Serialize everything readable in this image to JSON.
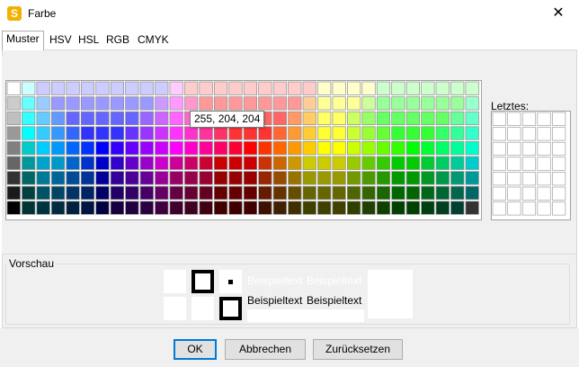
{
  "window": {
    "title": "Farbe",
    "icon": "app-logo-icon",
    "icon_glyph": "S",
    "close_glyph": "✕"
  },
  "tabs": [
    {
      "label": "Muster",
      "active": true
    },
    {
      "label": "HSV",
      "active": false
    },
    {
      "label": "HSL",
      "active": false
    },
    {
      "label": "RGB",
      "active": false
    },
    {
      "label": "CMYK",
      "active": false
    }
  ],
  "palette": {
    "tooltip": "255, 204, 204",
    "rows": [
      [
        "#FFFFFF",
        "#CCFFFF",
        "#CCCCFF",
        "#CCCCFF",
        "#CCCCFF",
        "#CCCCFF",
        "#CCCCFF",
        "#CCCCFF",
        "#CCCCFF",
        "#CCCCFF",
        "#CCCCFF",
        "#FFCCFF",
        "#FFCCCC",
        "#FFCCCC",
        "#FFCCCC",
        "#FFCCCC",
        "#FFCCCC",
        "#FFCCCC",
        "#FFCCCC",
        "#FFCCCC",
        "#FFCCCC",
        "#FFFFCC",
        "#FFFFCC",
        "#FFFFCC",
        "#FFFFCC",
        "#CCFFCC",
        "#CCFFCC",
        "#CCFFCC",
        "#CCFFCC",
        "#CCFFCC",
        "#CCFFCC",
        "#CCFFCC"
      ],
      [
        "#CCCCCC",
        "#66FFFF",
        "#99CCFF",
        "#9999FF",
        "#9999FF",
        "#9999FF",
        "#9999FF",
        "#9999FF",
        "#9999FF",
        "#9999FF",
        "#CC99FF",
        "#FF99FF",
        "#FF99CC",
        "#FF9999",
        "#FF9999",
        "#FF9999",
        "#FF9999",
        "#FF9999",
        "#FF9999",
        "#FF9999",
        "#FFCC99",
        "#FFFF99",
        "#FFFF99",
        "#FFFF99",
        "#CCFF99",
        "#99FF99",
        "#99FF99",
        "#99FF99",
        "#99FF99",
        "#99FF99",
        "#99FF99",
        "#99FFCC"
      ],
      [
        "#C0C0C0",
        "#33FFFF",
        "#66CCFF",
        "#6699FF",
        "#6666FF",
        "#6666FF",
        "#6666FF",
        "#6666FF",
        "#6666FF",
        "#9966FF",
        "#CC66FF",
        "#FF66FF",
        "#FF66CC",
        "#FF6699",
        "#FF6666",
        "#FF6666",
        "#FF6666",
        "#FF6666",
        "#FF6666",
        "#FF9966",
        "#FFCC66",
        "#FFFF66",
        "#FFFF66",
        "#CCFF66",
        "#99FF66",
        "#66FF66",
        "#66FF66",
        "#66FF66",
        "#66FF66",
        "#66FF66",
        "#66FF99",
        "#66FFCC"
      ],
      [
        "#999999",
        "#00FFFF",
        "#33CCFF",
        "#3399FF",
        "#3366FF",
        "#3333FF",
        "#3333FF",
        "#3333FF",
        "#6633FF",
        "#9933FF",
        "#CC33FF",
        "#FF33FF",
        "#FF33CC",
        "#FF3399",
        "#FF3366",
        "#FF3333",
        "#FF3333",
        "#FF3333",
        "#FF6633",
        "#FF9933",
        "#FFCC33",
        "#FFFF33",
        "#FFFF33",
        "#CCFF33",
        "#99FF33",
        "#66FF33",
        "#33FF33",
        "#33FF33",
        "#33FF33",
        "#33FF66",
        "#33FF99",
        "#33FFCC"
      ],
      [
        "#808080",
        "#00CCCC",
        "#00CCFF",
        "#0099FF",
        "#0066FF",
        "#0033FF",
        "#0000FF",
        "#3300FF",
        "#6600FF",
        "#9900FF",
        "#CC00FF",
        "#FF00FF",
        "#FF00CC",
        "#FF0099",
        "#FF0066",
        "#FF0033",
        "#FF0000",
        "#FF3300",
        "#FF6600",
        "#FF9900",
        "#FFCC00",
        "#FFFF00",
        "#FFFF00",
        "#CCFF00",
        "#99FF00",
        "#66FF00",
        "#33FF00",
        "#00FF00",
        "#00FF33",
        "#00FF66",
        "#00FF99",
        "#00FFCC"
      ],
      [
        "#666666",
        "#009999",
        "#00A3CC",
        "#0099CC",
        "#0066CC",
        "#0033CC",
        "#0000CC",
        "#3300CC",
        "#6600CC",
        "#9900CC",
        "#CC00CC",
        "#CC0099",
        "#CC0066",
        "#CC0033",
        "#CC0000",
        "#CC0000",
        "#CC0000",
        "#CC3300",
        "#CC6600",
        "#CC9900",
        "#CCCC00",
        "#CCCC00",
        "#CCCC00",
        "#99CC00",
        "#66CC00",
        "#33CC00",
        "#00CC00",
        "#00CC00",
        "#00CC33",
        "#00CC66",
        "#00CC99",
        "#00CCCC"
      ],
      [
        "#333333",
        "#006666",
        "#007A99",
        "#006699",
        "#004C99",
        "#003399",
        "#000099",
        "#330099",
        "#4C0099",
        "#660099",
        "#990099",
        "#990066",
        "#99004C",
        "#990033",
        "#990000",
        "#990000",
        "#990000",
        "#992600",
        "#994C00",
        "#997300",
        "#999900",
        "#999900",
        "#999900",
        "#739900",
        "#4C9900",
        "#269900",
        "#009900",
        "#009900",
        "#009926",
        "#00994C",
        "#009973",
        "#009999"
      ],
      [
        "#1A1A1A",
        "#004040",
        "#005266",
        "#004466",
        "#003366",
        "#002266",
        "#000066",
        "#220066",
        "#330066",
        "#440066",
        "#660066",
        "#660044",
        "#660033",
        "#660022",
        "#660000",
        "#660000",
        "#660000",
        "#661A00",
        "#663300",
        "#664D00",
        "#666600",
        "#666600",
        "#666600",
        "#4D6600",
        "#336600",
        "#1A6600",
        "#006600",
        "#006600",
        "#00661A",
        "#006633",
        "#00664D",
        "#006666"
      ],
      [
        "#000000",
        "#003333",
        "#003340",
        "#002B40",
        "#002040",
        "#001540",
        "#000040",
        "#150040",
        "#200040",
        "#2B0040",
        "#400040",
        "#40002B",
        "#400020",
        "#400015",
        "#400000",
        "#400000",
        "#400000",
        "#401000",
        "#402000",
        "#403000",
        "#404000",
        "#404000",
        "#404000",
        "#304000",
        "#204000",
        "#104000",
        "#004000",
        "#004000",
        "#004010",
        "#004020",
        "#004030",
        "#333333"
      ]
    ]
  },
  "recent": {
    "label": "Letztes:"
  },
  "preview": {
    "legend": "Vorschau",
    "sample_text_1": "Beispieltext",
    "sample_text_2": "Beispieltext"
  },
  "buttons": {
    "ok": "OK",
    "cancel": "Abbrechen",
    "reset": "Zurücksetzen"
  },
  "colors": {
    "accent": "#0078d7",
    "panel_bg": "#f0f0f0"
  }
}
